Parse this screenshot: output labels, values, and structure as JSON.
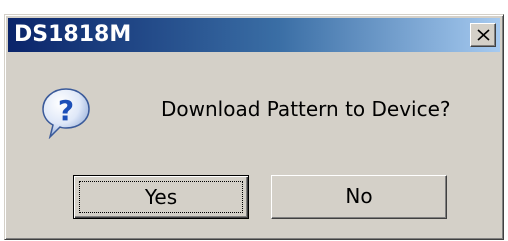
{
  "window": {
    "title": "DS1818M",
    "close_icon": "close-icon"
  },
  "message": {
    "icon": "question-icon",
    "text": "Download Pattern to Device?"
  },
  "buttons": {
    "yes_label": "Yes",
    "no_label": "No",
    "default": "yes"
  },
  "colors": {
    "dialog_face": "#d4d0c8",
    "titlebar_start": "#0a246a",
    "titlebar_end": "#a6caf0",
    "icon_blue": "#1c4fb8"
  }
}
